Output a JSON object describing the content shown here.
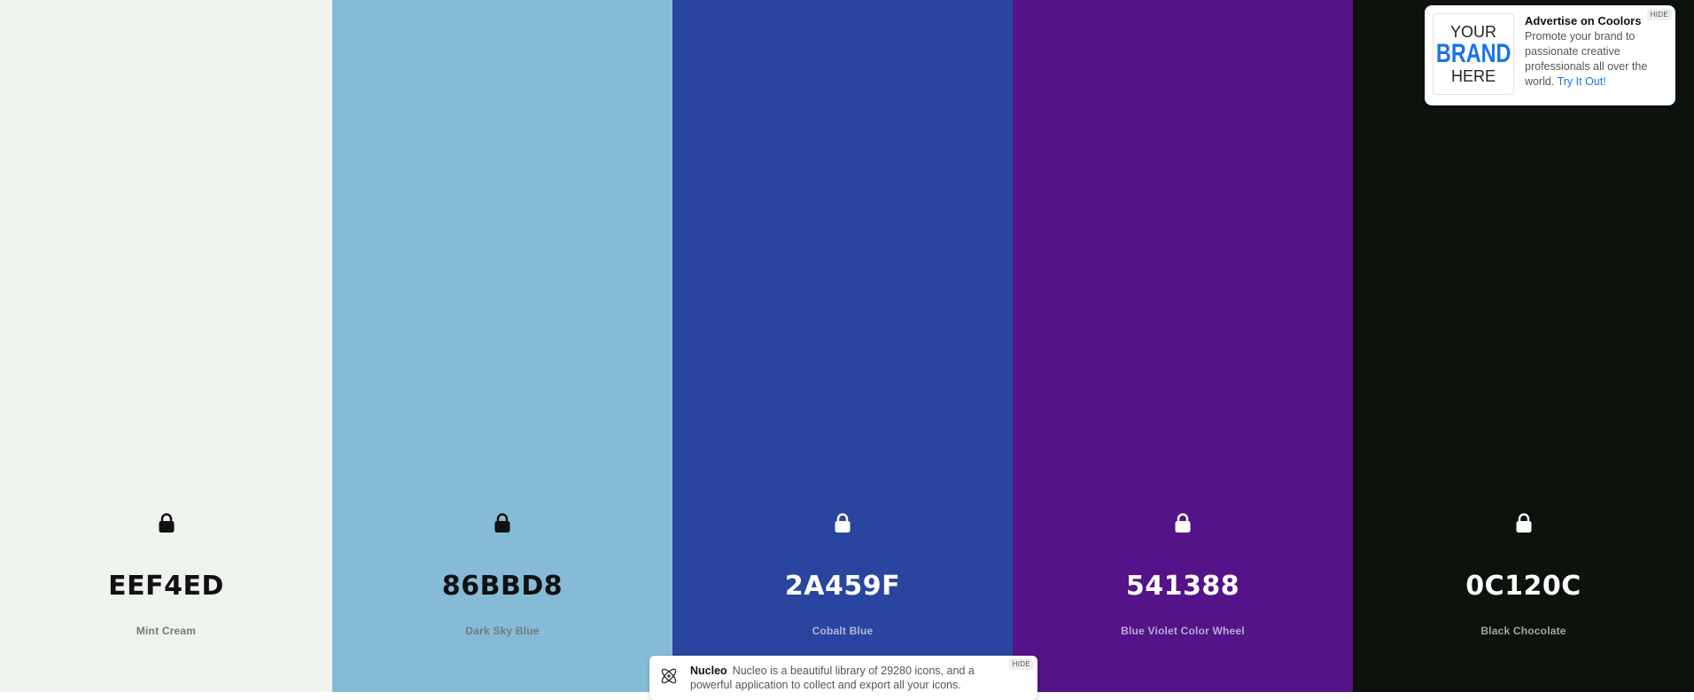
{
  "palette": {
    "colors": [
      {
        "hex": "EEF4ED",
        "name": "Mint Cream",
        "bg": "#EEF4ED",
        "tone": "light"
      },
      {
        "hex": "86BBD8",
        "name": "Dark Sky Blue",
        "bg": "#86BBD8",
        "tone": "light"
      },
      {
        "hex": "2A459F",
        "name": "Cobalt Blue",
        "bg": "#2A459F",
        "tone": "dark"
      },
      {
        "hex": "541388",
        "name": "Blue Violet Color Wheel",
        "bg": "#541388",
        "tone": "dark"
      },
      {
        "hex": "0C120C",
        "name": "Black Chocolate",
        "bg": "#0C120C",
        "tone": "dark"
      }
    ],
    "lock_icon": "lock-icon"
  },
  "ad": {
    "logo": {
      "line1": "YOUR",
      "line2": "BRAND",
      "line3": "HERE"
    },
    "title": "Advertise on Coolors",
    "body": "Promote your brand to passionate creative professionals all over the world.",
    "link": "Try It Out!",
    "hide_label": "HIDE",
    "link_color": "#1a73e8"
  },
  "nucleo": {
    "name": "Nucleo",
    "text": "Nucleo is a beautiful library of 29280 icons, and a powerful application to collect and export all your icons.",
    "hide_label": "HIDE",
    "icon": "atom-icon"
  }
}
